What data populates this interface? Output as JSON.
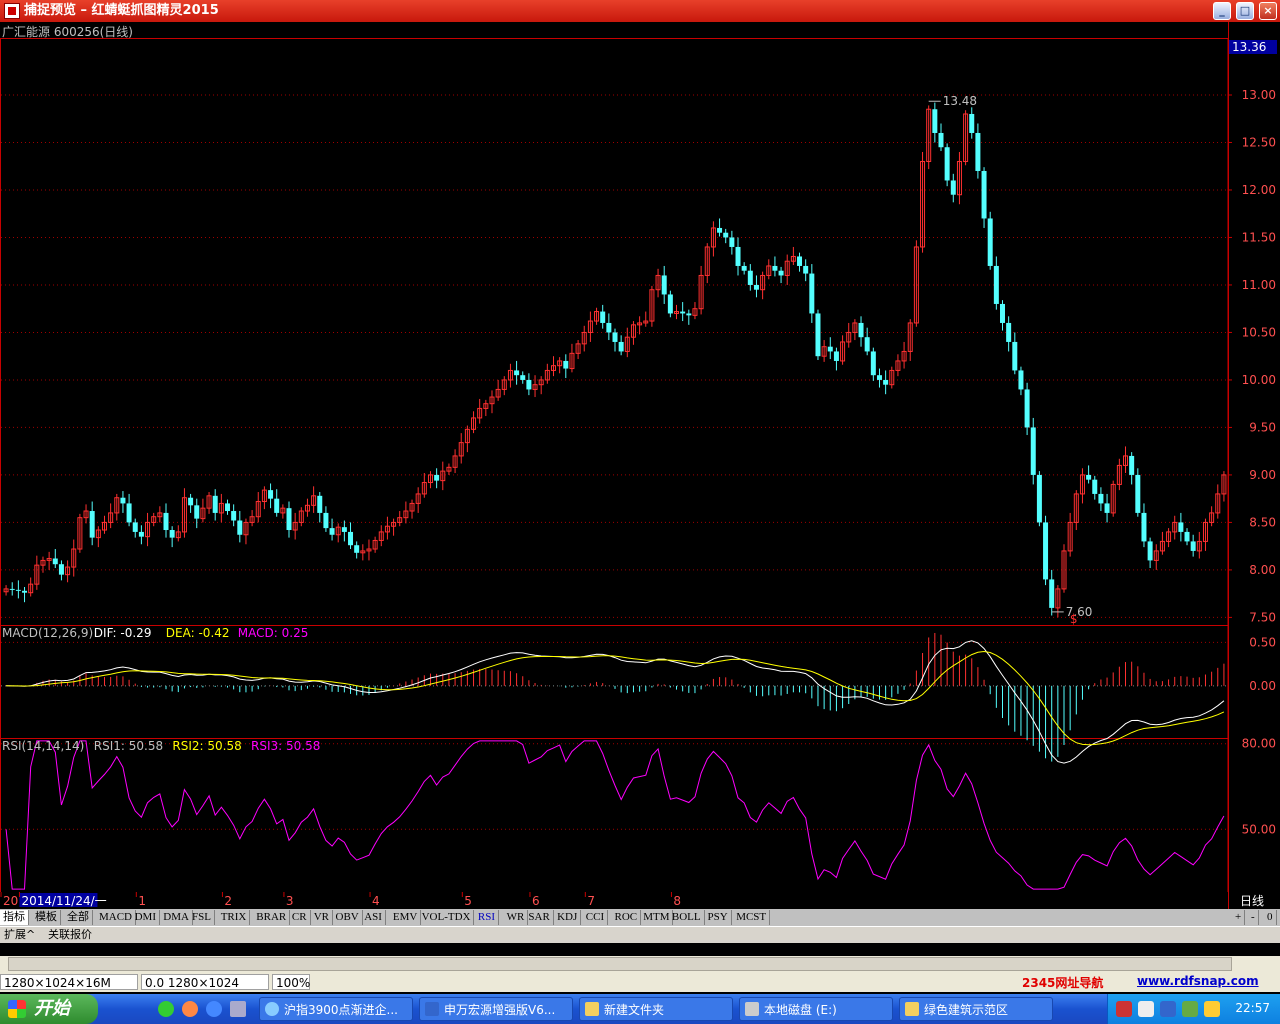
{
  "window": {
    "title": "捕捉预览 – 红蜻蜓抓图精灵2015"
  },
  "chart_header": {
    "stock": "广汇能源 600256(日线)"
  },
  "chart_data": [
    {
      "type": "candlestick",
      "title": "广汇能源 600256(日线)",
      "y_ticks": [
        "13.00",
        "12.50",
        "12.00",
        "11.50",
        "11.00",
        "10.50",
        "10.00",
        "9.50",
        "9.00",
        "8.50",
        "8.00",
        "7.50"
      ],
      "ylim": [
        7.42,
        13.6
      ],
      "last_price_label": "13.36",
      "annotations": {
        "high": "13.48",
        "low": "7.60",
        "signal": "$"
      },
      "x_labels": [
        {
          "text": "2014年",
          "i": 0
        },
        {
          "text": "2014/11/24/一",
          "i": 3
        },
        {
          "text": "1",
          "i": 22
        },
        {
          "text": "2",
          "i": 36
        },
        {
          "text": "3",
          "i": 46
        },
        {
          "text": "4",
          "i": 60
        },
        {
          "text": "5",
          "i": 75
        },
        {
          "text": "6",
          "i": 86
        },
        {
          "text": "7",
          "i": 95
        },
        {
          "text": "8",
          "i": 109
        }
      ],
      "period_label": "日线",
      "closes": [
        7.8,
        7.79,
        7.78,
        7.76,
        7.85,
        8.05,
        8.1,
        8.12,
        8.06,
        7.95,
        8.03,
        8.22,
        8.55,
        8.62,
        8.34,
        8.42,
        8.5,
        8.6,
        8.76,
        8.7,
        8.5,
        8.4,
        8.35,
        8.5,
        8.56,
        8.6,
        8.42,
        8.34,
        8.4,
        8.76,
        8.68,
        8.54,
        8.65,
        8.78,
        8.6,
        8.7,
        8.62,
        8.52,
        8.37,
        8.5,
        8.56,
        8.72,
        8.84,
        8.75,
        8.6,
        8.65,
        8.42,
        8.5,
        8.62,
        8.68,
        8.78,
        8.6,
        8.44,
        8.37,
        8.45,
        8.4,
        8.26,
        8.18,
        8.2,
        8.22,
        8.31,
        8.4,
        8.46,
        8.5,
        8.55,
        8.62,
        8.7,
        8.8,
        8.92,
        9.0,
        8.94,
        9.04,
        9.08,
        9.2,
        9.34,
        9.48,
        9.6,
        9.7,
        9.75,
        9.82,
        9.9,
        10.0,
        10.1,
        10.05,
        10.0,
        9.9,
        9.95,
        10.0,
        10.1,
        10.15,
        10.2,
        10.12,
        10.28,
        10.38,
        10.5,
        10.62,
        10.72,
        10.6,
        10.5,
        10.4,
        10.3,
        10.45,
        10.58,
        10.6,
        10.62,
        10.95,
        11.1,
        10.9,
        10.7,
        10.72,
        10.7,
        10.68,
        10.75,
        11.1,
        11.4,
        11.6,
        11.55,
        11.5,
        11.4,
        11.2,
        11.15,
        11.0,
        10.95,
        11.1,
        11.2,
        11.15,
        11.1,
        11.25,
        11.3,
        11.2,
        11.12,
        10.7,
        10.25,
        10.35,
        10.3,
        10.2,
        10.4,
        10.5,
        10.6,
        10.45,
        10.3,
        10.05,
        10.0,
        9.95,
        10.1,
        10.2,
        10.3,
        10.6,
        11.4,
        12.3,
        12.85,
        12.6,
        12.45,
        12.1,
        11.95,
        12.3,
        12.8,
        12.6,
        12.2,
        11.7,
        11.2,
        10.8,
        10.6,
        10.4,
        10.1,
        9.9,
        9.5,
        9.0,
        8.5,
        7.9,
        7.6,
        7.8,
        8.2,
        8.5,
        8.8,
        9.0,
        8.95,
        8.8,
        8.7,
        8.6,
        8.9,
        9.1,
        9.2,
        9.0,
        8.6,
        8.3,
        8.1,
        8.2,
        8.3,
        8.4,
        8.5,
        8.4,
        8.3,
        8.2,
        8.3,
        8.5,
        8.6,
        8.8,
        9.0
      ]
    },
    {
      "type": "macd",
      "legend": {
        "name": "MACD(12,26,9)",
        "dif": "DIF: -0.29",
        "dea": "DEA: -0.42",
        "macd": "MACD: 0.25"
      },
      "y_ticks": [
        "0.50",
        "0.00"
      ],
      "ylim": [
        -0.6,
        0.7
      ]
    },
    {
      "type": "rsi",
      "legend": {
        "name": "RSI(14,14,14)",
        "rsi1": "RSI1: 50.58",
        "rsi2": "RSI2: 50.58",
        "rsi3": "RSI3: 50.58"
      },
      "y_ticks": [
        "80.00",
        "50.00"
      ],
      "ylim": [
        28,
        82
      ]
    }
  ],
  "colors": {
    "up": "#ff3030",
    "down": "#54ffff",
    "grid": "#a00000",
    "axis": "#c80000",
    "text": "#ff5050",
    "dif": "#ffffff",
    "dea": "#ffff00",
    "rsi": "#ff00ff"
  },
  "tabs": [
    "指标",
    "模板",
    "全部",
    "MACD",
    "DMI",
    "DMA",
    "FSL",
    "TRIX",
    "BRAR",
    "CR",
    "VR",
    "OBV",
    "ASI",
    "EMV",
    "VOL-TDX",
    "RSI",
    "WR",
    "SAR",
    "KDJ",
    "CCI",
    "ROC",
    "MTM",
    "BOLL",
    "PSY",
    "MCST"
  ],
  "tab_controls": [
    "+",
    "-",
    "0"
  ],
  "ext_tabs": [
    "扩展^",
    "关联报价"
  ],
  "status": {
    "resolution": "1280×1024×16M",
    "coords": "0.0 1280×1024",
    "zoom": "100%",
    "ad_nav": "2345网址导航",
    "ad_url": "www.rdfsnap.com"
  },
  "taskbar": {
    "start": "开始",
    "items": [
      "沪指3900点渐进企...",
      "申万宏源增强版V6...",
      "新建文件夹",
      "本地磁盘 (E:)",
      "绿色建筑示范区"
    ],
    "clock": "22:57"
  }
}
